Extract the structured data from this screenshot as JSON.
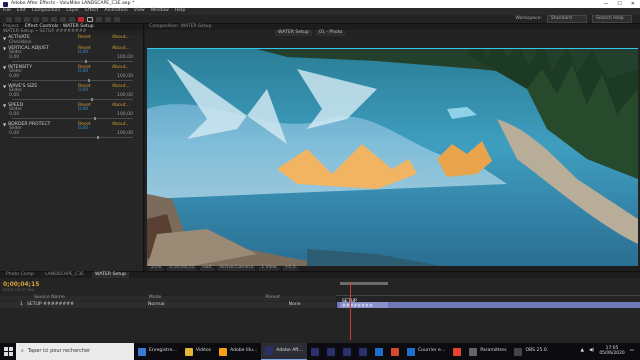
{
  "window": {
    "title": "Adobe After Effects - VoluMike LANDSCAPE_C3E.aep *"
  },
  "menu": [
    "File",
    "Edit",
    "Composition",
    "Layer",
    "Effect",
    "Animation",
    "View",
    "Window",
    "Help"
  ],
  "toolbar": {
    "workspace_label": "Workspace:",
    "workspace_value": "Standard",
    "search_placeholder": "Search Help"
  },
  "effects_panel": {
    "tabs": [
      "Project",
      "Effect Controls : WATER Setup"
    ],
    "header": "WATER Setup • SETUP ########",
    "groups": [
      {
        "name": "ACTIVATE",
        "reset": "Reset",
        "about": "About...",
        "subs": [
          {
            "label": "Checkbox",
            "value": ""
          }
        ]
      },
      {
        "name": "VERTICAL ADJUST",
        "reset": "Reset",
        "about": "About...",
        "subs": [
          {
            "label": "Slider",
            "value": "0,00"
          }
        ],
        "min": "0,00",
        "max": "100,00"
      },
      {
        "name": "INTENSITY",
        "reset": "Reset",
        "about": "About...",
        "subs": [
          {
            "label": "Slider",
            "value": "0,00"
          }
        ],
        "min": "0,00",
        "max": "100,00"
      },
      {
        "name": "WAVE'S SIZE",
        "reset": "Reset",
        "about": "About...",
        "subs": [
          {
            "label": "Slider",
            "value": "0,00"
          }
        ],
        "min": "0,00",
        "max": "100,00"
      },
      {
        "name": "SPEED",
        "reset": "Reset",
        "about": "About...",
        "subs": [
          {
            "label": "Slider",
            "value": "0,00"
          }
        ],
        "min": "0,00",
        "max": "100,00"
      },
      {
        "name": "BORDER PROTECT",
        "reset": "Reset",
        "about": "About...",
        "subs": [
          {
            "label": "Slider",
            "value": "0,00"
          }
        ],
        "min": "0,00",
        "max": "100,00"
      }
    ]
  },
  "viewer": {
    "panel_tab": "Composition: WATER Setup",
    "comp_tabs": [
      "WATER Setup",
      "01 - Photo"
    ],
    "footer": {
      "zoom": "25%",
      "timecode": "0;00;04;15",
      "res": "Half",
      "camera": "Active Camera",
      "views": "1 View",
      "exposure": "+0,0"
    }
  },
  "timeline": {
    "tabs": [
      "Photo Comp",
      "LANDSCAPE_C3E",
      "WATER Setup"
    ],
    "active_tab": "WATER Setup",
    "timecode": "0;00;04;15",
    "fps": "00135 (29.97 fps)",
    "layer_header": {
      "name_col": "Source Name",
      "mode_col": "Mode",
      "parent_col": "Parent"
    },
    "layer": {
      "index": "1",
      "name": "SETUP ########",
      "mode": "Normal",
      "parent": "None",
      "bar_label": "SETUP ########"
    }
  },
  "taskbar": {
    "search_placeholder": "Taper ici pour rechercher",
    "items": [
      {
        "label": "Enregistre...",
        "color": "#3a7bd5"
      },
      {
        "label": "Vidéos",
        "color": "#e3b53a"
      },
      {
        "label": "Adobe Illu...",
        "color": "#f7a21a"
      },
      {
        "label": "Adobe Aft...",
        "color": "#2b2f6b"
      },
      {
        "label": "",
        "color": "#2b2f6b"
      },
      {
        "label": "",
        "color": "#2b2f6b"
      },
      {
        "label": "",
        "color": "#2b2f6b"
      },
      {
        "label": "",
        "color": "#2b2f6b"
      },
      {
        "label": "",
        "color": "#1f6fc8"
      },
      {
        "label": "",
        "color": "#d44c2c"
      },
      {
        "label": "Courrier e...",
        "color": "#1a73c9"
      },
      {
        "label": "",
        "color": "#e8452f"
      },
      {
        "label": "Paramètres",
        "color": "#666666"
      },
      {
        "label": "OBS 25.0.",
        "color": "#444444"
      }
    ],
    "time": "17:05",
    "date": "05/06/2020"
  }
}
